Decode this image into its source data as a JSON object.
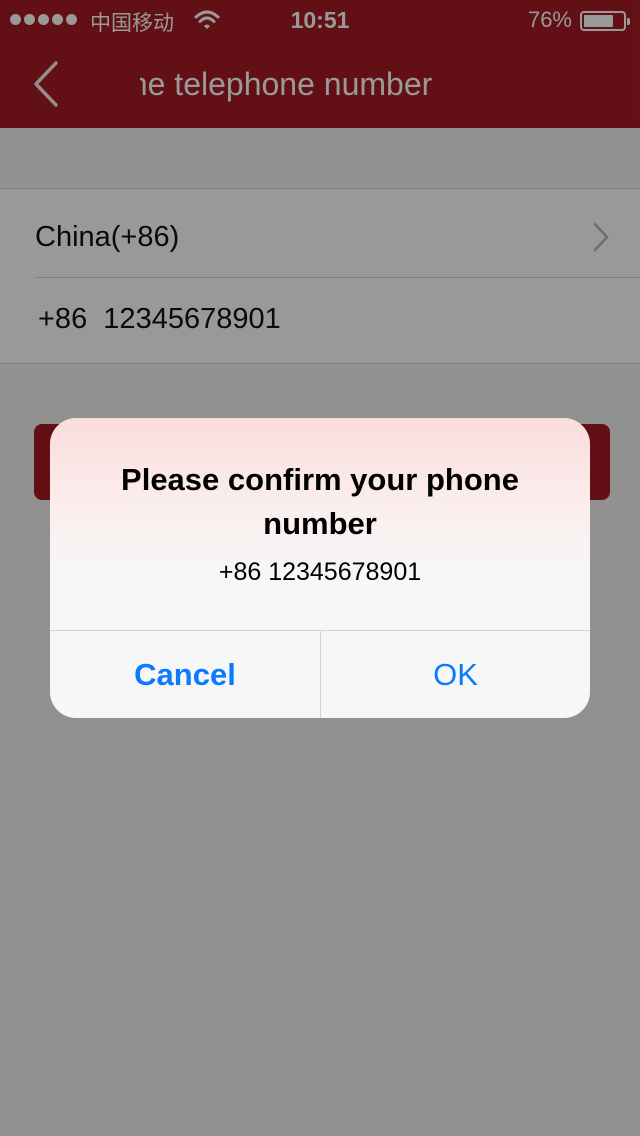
{
  "status_bar": {
    "carrier": "中国移动",
    "time": "10:51",
    "battery_percent": "76%",
    "battery_level": 0.76,
    "signal_bars": 5
  },
  "nav": {
    "title": "Verify the telephone number",
    "back_icon": "chevron-left-icon"
  },
  "form": {
    "country": "China(+86)",
    "phone": "+86  12345678901",
    "country_chevron_icon": "chevron-right-icon"
  },
  "dialog": {
    "title": "Please confirm your phone number",
    "message": "+86 12345678901",
    "cancel_label": "Cancel",
    "ok_label": "OK"
  },
  "colors": {
    "header": "#a31c23",
    "dialog_button": "#0a7aff",
    "overlay": "rgba(0,0,0,0.40)"
  }
}
